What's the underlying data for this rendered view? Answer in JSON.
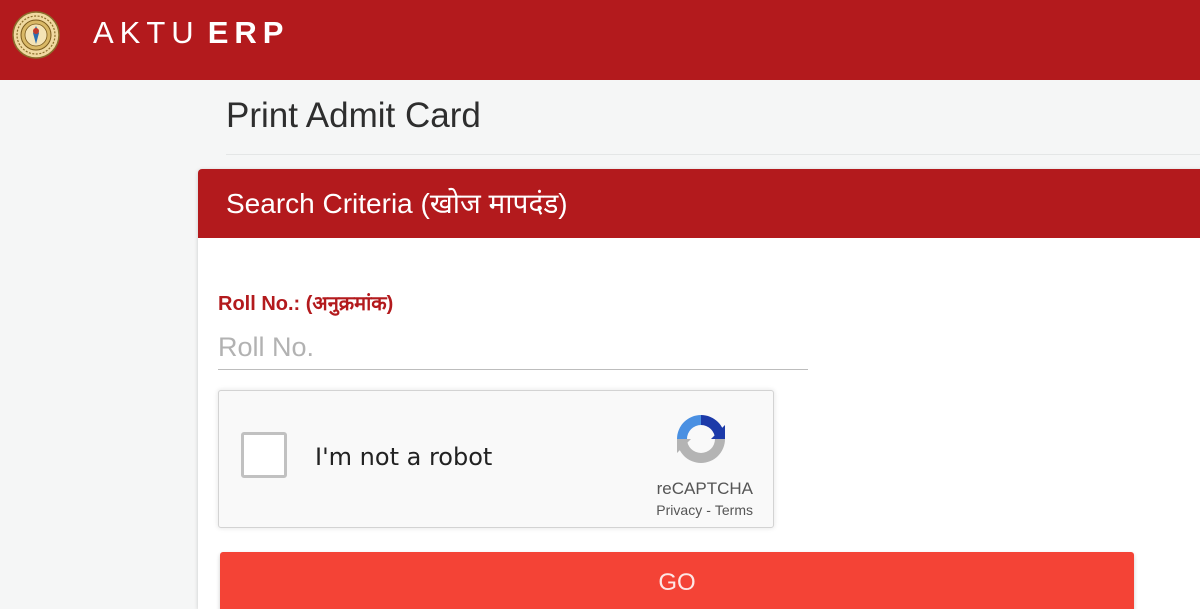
{
  "header": {
    "brand_prefix": "AKTU",
    "brand_suffix": "ERP",
    "logo_icon": "university-seal-icon",
    "background_color": "#b31a1d"
  },
  "page": {
    "title": "Print Admit Card"
  },
  "search_panel": {
    "heading": "Search Criteria (खोज मापदंड)",
    "roll_label": "Roll No.: (अनुक्रमांक)",
    "roll_placeholder": "Roll No.",
    "roll_value": ""
  },
  "recaptcha": {
    "label": "I'm not a robot",
    "brand": "reCAPTCHA",
    "privacy": "Privacy",
    "separator": "-",
    "terms": "Terms",
    "checked": false
  },
  "actions": {
    "go_label": "GO",
    "go_color": "#f44336"
  }
}
